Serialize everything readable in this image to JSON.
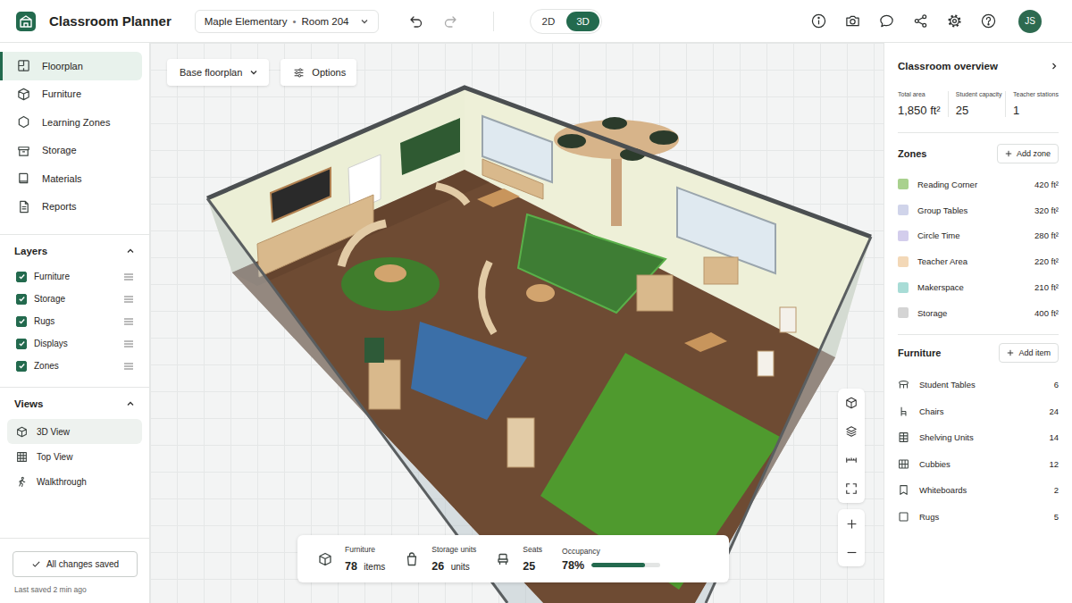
{
  "app": {
    "title": "Classroom Planner"
  },
  "location": {
    "school": "Maple Elementary",
    "separator": "•",
    "room": "Room 204"
  },
  "view_toggle": [
    {
      "label": "2D",
      "selected": false
    },
    {
      "label": "3D",
      "selected": true
    }
  ],
  "user": {
    "initials": "JS"
  },
  "nav": [
    {
      "label": "Floorplan",
      "selected": true
    },
    {
      "label": "Furniture",
      "selected": false
    },
    {
      "label": "Learning Zones",
      "selected": false
    },
    {
      "label": "Storage",
      "selected": false
    },
    {
      "label": "Materials",
      "selected": false
    },
    {
      "label": "Reports",
      "selected": false
    }
  ],
  "layers": {
    "title": "Layers",
    "expanded": true,
    "items": [
      {
        "label": "Furniture",
        "checked": true
      },
      {
        "label": "Storage",
        "checked": true
      },
      {
        "label": "Rugs",
        "checked": true
      },
      {
        "label": "Displays",
        "checked": true
      },
      {
        "label": "Zones",
        "checked": true
      }
    ]
  },
  "views": {
    "title": "Views",
    "expanded": true,
    "items": [
      {
        "label": "3D View",
        "selected": true
      },
      {
        "label": "Top View",
        "selected": false
      },
      {
        "label": "Walkthrough",
        "selected": false
      }
    ]
  },
  "save": {
    "button": "All changes saved",
    "status": "Last saved 2 min ago"
  },
  "canvas": {
    "floorplan_select": "Base floorplan",
    "options_button": "Options"
  },
  "stats": [
    {
      "label": "Furniture",
      "value": "78",
      "unit": "items",
      "kind": "count"
    },
    {
      "label": "Storage units",
      "value": "26",
      "unit": "units",
      "kind": "count"
    },
    {
      "label": "Seats",
      "value": "25",
      "unit": "",
      "kind": "count"
    },
    {
      "label": "Occupancy",
      "value": "78%",
      "kind": "meter",
      "level": 0.78
    }
  ],
  "overview": {
    "title": "Classroom overview",
    "metrics": [
      {
        "label": "Total area",
        "value": "1,850 ft²"
      },
      {
        "label": "Student capacity",
        "value": "25"
      },
      {
        "label": "Teacher stations",
        "value": "1"
      }
    ]
  },
  "zones": {
    "title": "Zones",
    "add_button": "Add zone",
    "items": [
      {
        "name": "Reading Corner",
        "area": "420 ft²",
        "color": "#a9d18e"
      },
      {
        "name": "Group Tables",
        "area": "320 ft²",
        "color": "#d0d4ea"
      },
      {
        "name": "Circle Time",
        "area": "280 ft²",
        "color": "#d3cdec"
      },
      {
        "name": "Teacher Area",
        "area": "220 ft²",
        "color": "#f3d8b7"
      },
      {
        "name": "Makerspace",
        "area": "210 ft²",
        "color": "#a8dcd6"
      },
      {
        "name": "Storage",
        "area": "400 ft²",
        "color": "#d4d4d4"
      }
    ]
  },
  "furniture": {
    "title": "Furniture",
    "add_button": "Add item",
    "items": [
      {
        "name": "Student Tables",
        "count": "6"
      },
      {
        "name": "Chairs",
        "count": "24"
      },
      {
        "name": "Shelving Units",
        "count": "14"
      },
      {
        "name": "Cubbies",
        "count": "12"
      },
      {
        "name": "Whiteboards",
        "count": "2"
      },
      {
        "name": "Rugs",
        "count": "5"
      }
    ]
  }
}
